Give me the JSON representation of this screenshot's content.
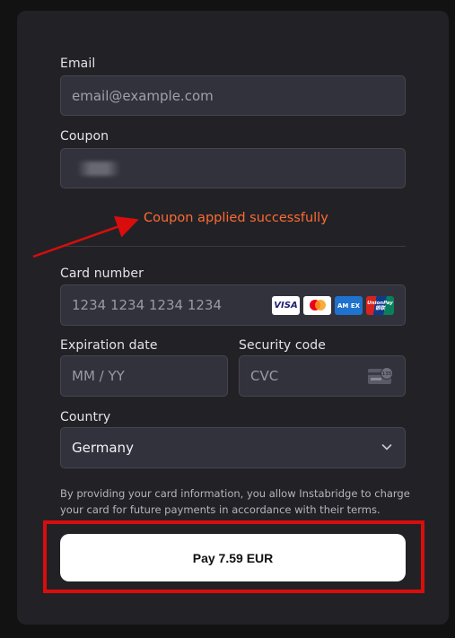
{
  "form": {
    "email_label": "Email",
    "email_placeholder": "email@example.com",
    "coupon_label": "Coupon",
    "coupon_status": "Coupon applied successfully",
    "card_number_label": "Card number",
    "card_number_placeholder": "1234 1234 1234 1234",
    "card_brands": [
      "VISA",
      "Mastercard",
      "AMEX",
      "UnionPay"
    ],
    "brand_labels": {
      "visa": "VISA",
      "amex": "AM EX",
      "unionpay": "UnionPay 银联"
    },
    "expiry_label": "Expiration date",
    "expiry_placeholder": "MM / YY",
    "cvc_label": "Security code",
    "cvc_placeholder": "CVC",
    "cvc_icon_text": "135",
    "country_label": "Country",
    "country_value": "Germany",
    "terms": "By providing your card information, you allow Instabridge to charge your card for future payments in accordance with their terms.",
    "pay_button": "Pay 7.59 EUR"
  },
  "icons": {
    "country_select": "chevron-down-icon",
    "cvc": "card-back-icon"
  },
  "colors": {
    "success": "#ff6a33",
    "annotation": "#d90d0d",
    "pay_button_bg": "#ffffff"
  }
}
